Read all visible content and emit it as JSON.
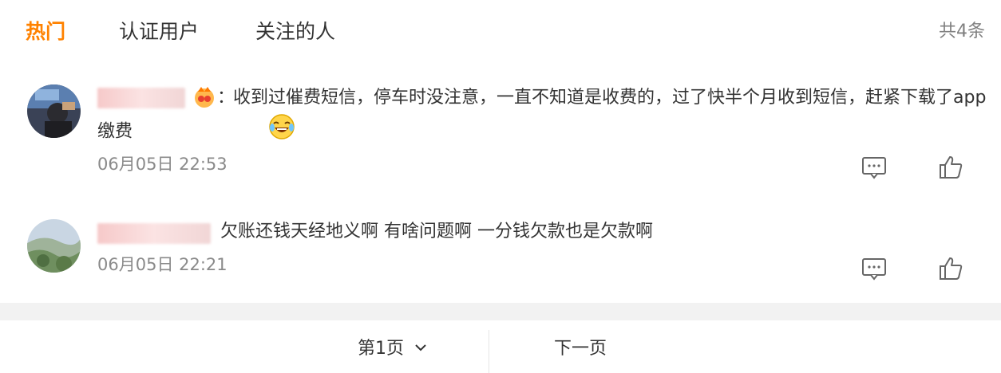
{
  "tabs": [
    {
      "label": "热门",
      "active": true
    },
    {
      "label": "认证用户",
      "active": false
    },
    {
      "label": "关注的人",
      "active": false
    }
  ],
  "total_count": "共4条",
  "comments": [
    {
      "username_blurred": true,
      "badge_icon": "vip-fan-badge-icon",
      "separator": "：",
      "text": "收到过催费短信，停车时没注意，一直不知道是收费的，过了快半个月收到短信，赶紧下载了app缴费",
      "trailing_emoji": "laugh-cry-emoji-icon",
      "time": "06月05日 22:53"
    },
    {
      "username_blurred": true,
      "text": "欠账还钱天经地义啊 有啥问题啊 一分钱欠款也是欠款啊",
      "time": "06月05日 22:21"
    }
  ],
  "pager": {
    "page_label": "第1页",
    "next_label": "下一页"
  },
  "colors": {
    "accent": "#ff8200",
    "muted": "#8a8a8a",
    "band": "#f2f2f2"
  }
}
